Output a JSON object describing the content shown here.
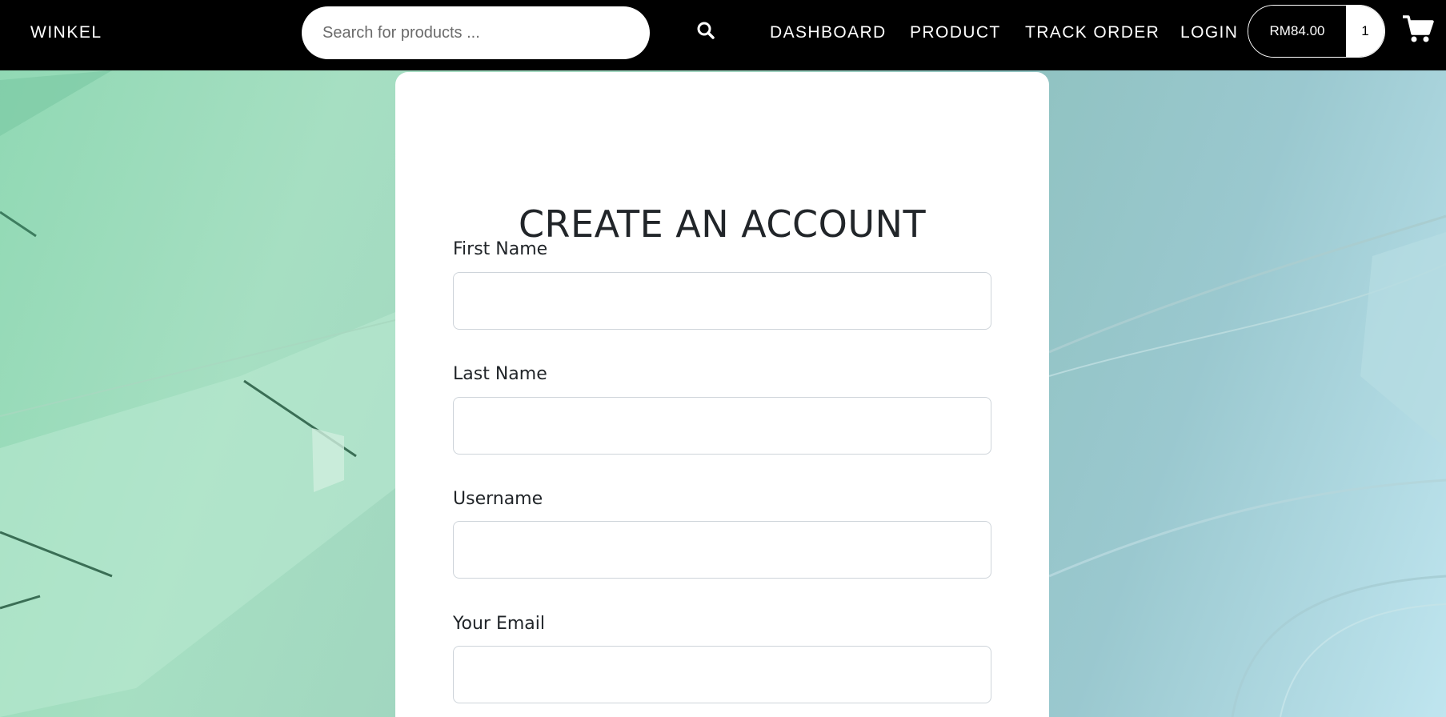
{
  "navbar": {
    "brand": "WINKEL",
    "search": {
      "placeholder": "Search for products ...",
      "value": ""
    },
    "search_icon": "search-icon",
    "links": [
      "DASHBOARD",
      "PRODUCT",
      "TRACK ORDER",
      "LOGIN"
    ],
    "cart": {
      "total": "RM84.00",
      "count": "1",
      "icon": "cart-icon"
    }
  },
  "form": {
    "title": "CREATE AN ACCOUNT",
    "fields": [
      {
        "label": "First Name",
        "value": ""
      },
      {
        "label": "Last Name",
        "value": ""
      },
      {
        "label": "Username",
        "value": ""
      },
      {
        "label": "Your Email",
        "value": ""
      }
    ]
  },
  "colors": {
    "navbar_bg": "#000000",
    "background_start": "#8fd8b3",
    "background_end": "#bfe5ef",
    "card_bg": "#ffffff",
    "title_text": "#212529"
  }
}
